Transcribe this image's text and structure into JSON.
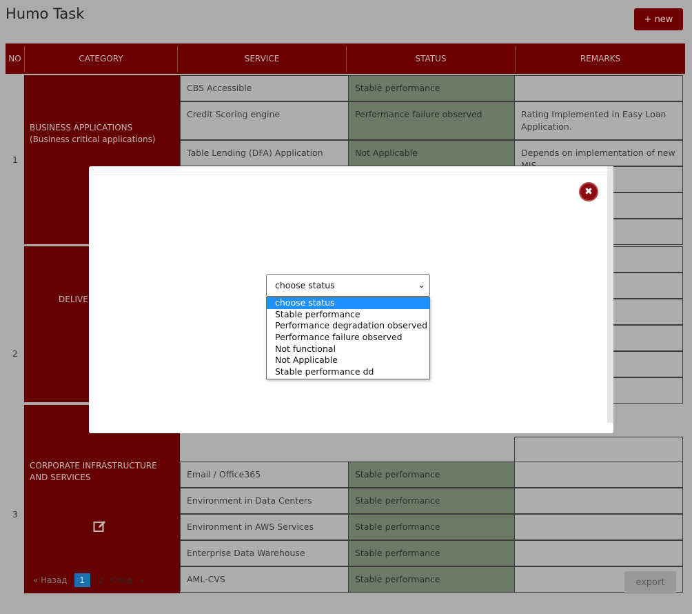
{
  "app": {
    "title": "Humo Task",
    "new_label": "+ new"
  },
  "table": {
    "headers": [
      "NO",
      "CATEGORY",
      "SERVICE",
      "STATUS",
      "REMARKS"
    ],
    "groups": [
      {
        "no": "1",
        "category": "BUSINESS APPLICATIONS (Business critical applications)",
        "rows": [
          {
            "service": "CBS Accessible",
            "status": "Stable performance",
            "remarks": ""
          },
          {
            "service": "Credit Scoring engine",
            "status": "Performance failure observed",
            "remarks": "Rating Implemented in Easy Loan Application."
          },
          {
            "service": "Table Lending (DFA) Application",
            "status": "Not Applicable",
            "remarks": "Depends on implementation of new MIS"
          }
        ]
      },
      {
        "no": "2",
        "category": "DELIVE"
      },
      {
        "no": "3",
        "category": "CORPORATE INFRASTRUCTURE AND SERVICES",
        "rows": [
          {
            "service": "Email / Office365",
            "status": "Stable performance",
            "remarks": ""
          },
          {
            "service": "Environment in Data Centers",
            "status": "Stable performance",
            "remarks": ""
          },
          {
            "service": "Environment in AWS Services",
            "status": "Stable performance",
            "remarks": ""
          },
          {
            "service": "Enterprise Data Warehouse",
            "status": "Stable performance",
            "remarks": ""
          },
          {
            "service": "AML-CVS",
            "status": "Stable performance",
            "remarks": ""
          }
        ]
      }
    ]
  },
  "pagination": {
    "prev": "« Назад",
    "pages": [
      "1",
      "2"
    ],
    "current": "1",
    "next": "След",
    "next_arrow": "»"
  },
  "export_label": "export",
  "modal": {
    "close_icon": "close-icon",
    "select": {
      "value": "choose status",
      "options": [
        "choose status",
        "Stable performance",
        "Performance degradation observed",
        "Performance failure observed",
        "Not functional",
        "Not Applicable",
        "Stable performance dd"
      ]
    }
  },
  "colors": {
    "header": "#6a0000",
    "category": "#640000",
    "accent_button": "#6e0000",
    "status_cell": "#6c7a68",
    "page_active": "#1d6fb2",
    "option_highlight": "#1e90ff",
    "close_button": "#8b0d12"
  }
}
